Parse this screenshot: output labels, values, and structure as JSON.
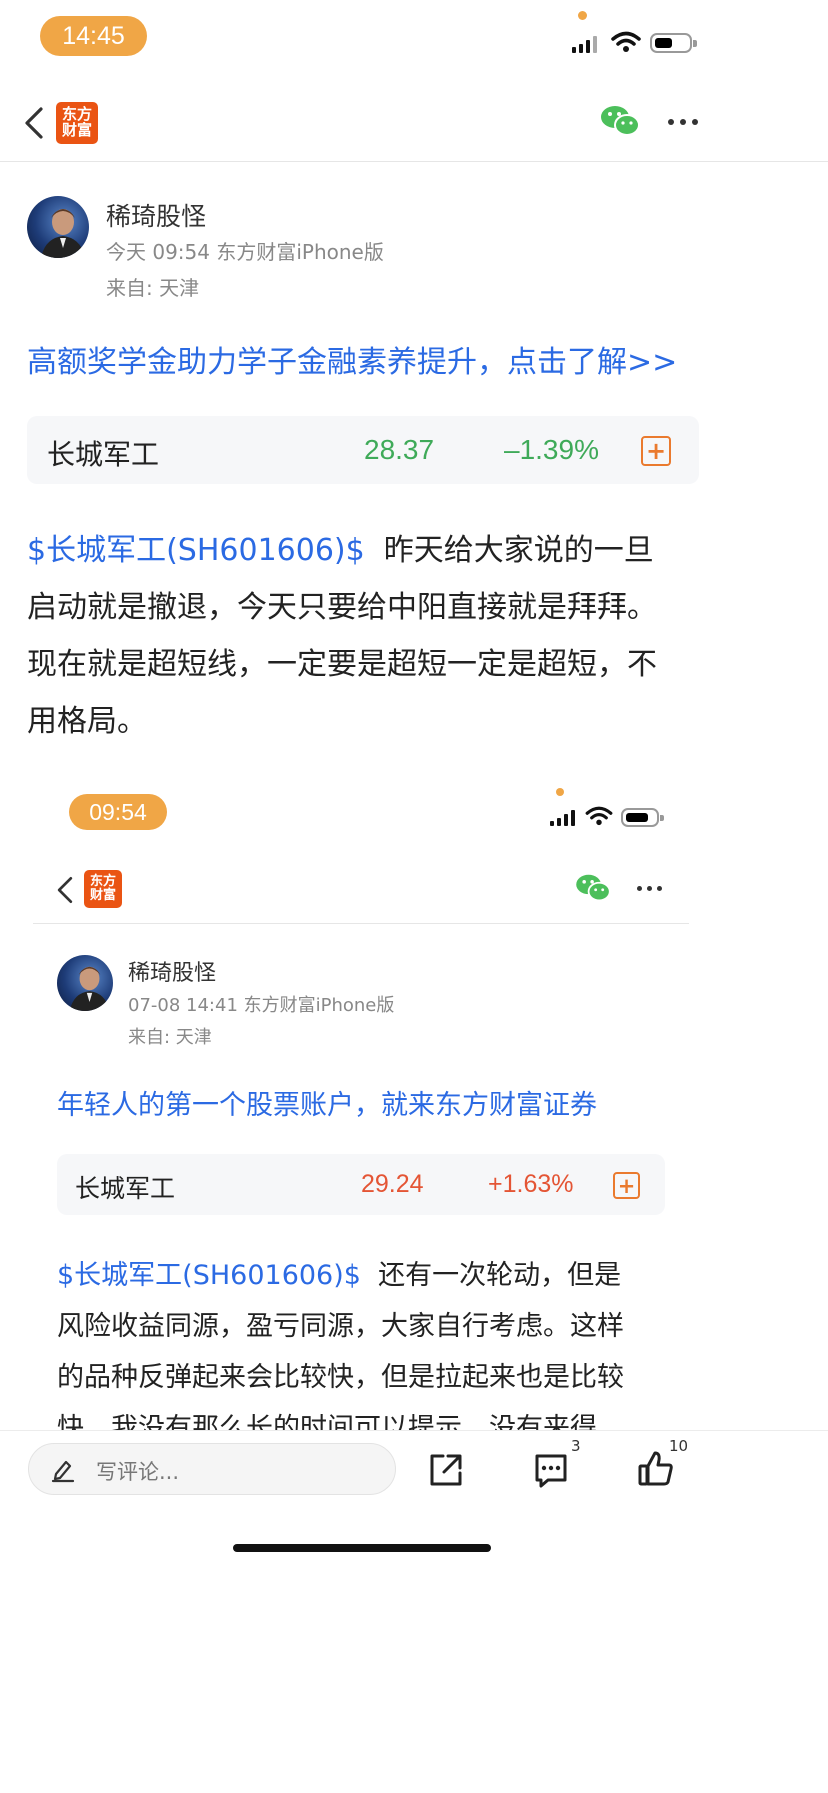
{
  "status_bar": {
    "time": "14:45"
  },
  "nav": {
    "logo_line1": "东方",
    "logo_line2": "财富"
  },
  "post": {
    "username": "稀琦股怪",
    "timestamp": "今天 09:54 东方财富iPhone版",
    "location": "来自: 天津",
    "promo_link": "高额奖学金助力学子金融素养提升，点击了解>>",
    "stock": {
      "name": "长城军工",
      "price": "28.37",
      "change": "–1.39%"
    },
    "tag": "$长城军工(SH601606)$",
    "text_line1": "昨天给大家说的一旦",
    "text_line2": "启动就是撤退，今天只要给中阳直接就是拜拜。",
    "text_line3": "现在就是超短线，一定要是超短一定是超短，不",
    "text_line4": "用格局。"
  },
  "embedded": {
    "status_time": "09:54",
    "logo_line1": "东方",
    "logo_line2": "财富",
    "username": "稀琦股怪",
    "timestamp": "07-08 14:41 东方财富iPhone版",
    "location": "来自: 天津",
    "promo_link": "年轻人的第一个股票账户，就来东方财富证券",
    "stock": {
      "name": "长城军工",
      "price": "29.24",
      "change": "+1.63%"
    },
    "tag": "$长城军工(SH601606)$",
    "text_line1": "还有一次轮动，但是",
    "text_line2": "风险收益同源，盈亏同源，大家自行考虑。这样",
    "text_line3": "的品种反弹起来会比较快，但是拉起来也是比较",
    "text_line4": "快，我没有那么长的时间可以提示，没有来得"
  },
  "bottom_bar": {
    "comment_placeholder": "写评论...",
    "comment_count": "3",
    "like_count": "10"
  },
  "colors": {
    "accent": "#2b6ae3",
    "up": "#e45535",
    "down": "#3faa59",
    "brand": "#ea5413",
    "time_pill": "#f0a646"
  },
  "icons": [
    "back-chevron-icon",
    "wechat-icon",
    "more-icon",
    "plus-icon",
    "pencil-icon",
    "share-icon",
    "comment-icon",
    "like-icon"
  ]
}
